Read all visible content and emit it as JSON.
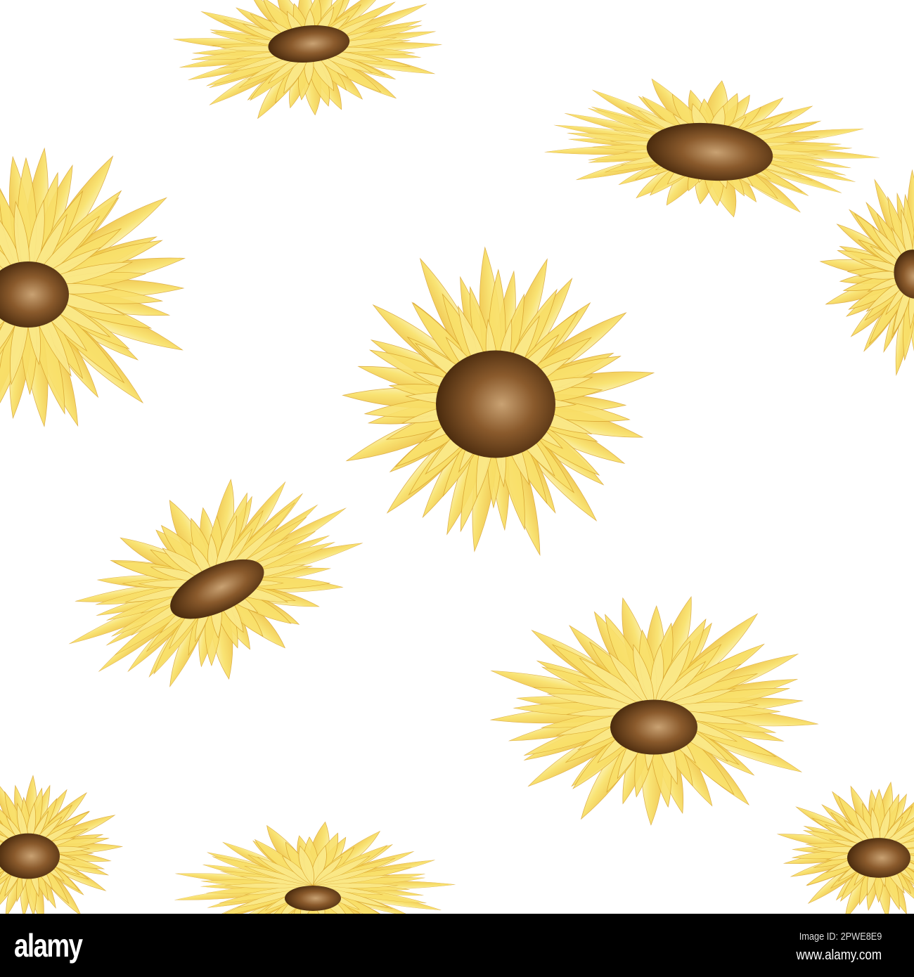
{
  "image": {
    "subject": "watercolor sunflower seamless pattern",
    "colors": {
      "petal": "#f6d84a",
      "petal_light": "#fbe98a",
      "petal_dark": "#e9b436",
      "center": "#5a3414",
      "center_light": "#b58a55",
      "background": "#ffffff"
    }
  },
  "watermark": {
    "logo": "alamy",
    "image_id": "Image ID: 2PWE8E9",
    "url": "www.alamy.com"
  }
}
